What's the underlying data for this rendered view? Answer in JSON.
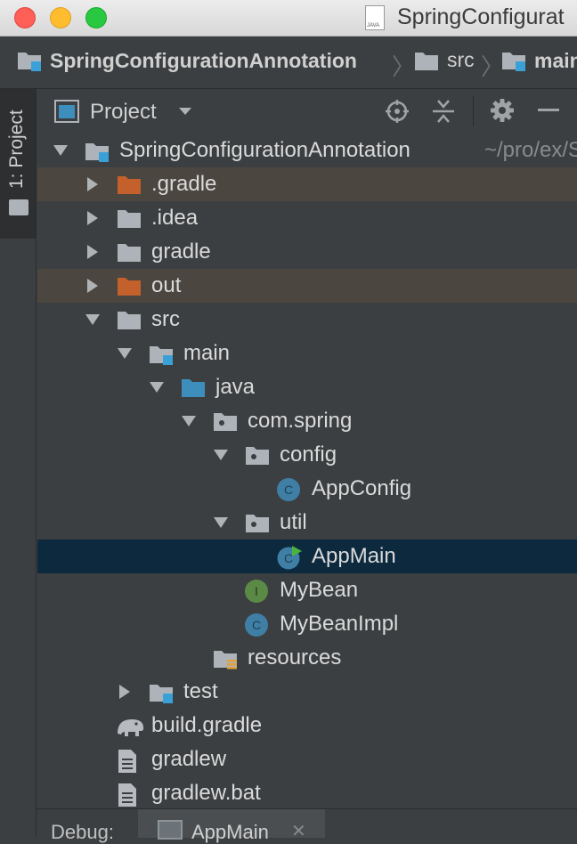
{
  "window": {
    "title": "SpringConfigurat",
    "file_icon": "java-file-icon"
  },
  "breadcrumbs": [
    {
      "label": "SpringConfigurationAnnotation",
      "icon": "module-folder-icon"
    },
    {
      "label": "src",
      "icon": "folder-icon"
    },
    {
      "label": "main",
      "icon": "source-folder-icon"
    }
  ],
  "tool_window": {
    "tab_label": "1: Project",
    "view_selector": "Project",
    "actions": [
      "locate-icon",
      "collapse-all-icon",
      "gear-icon",
      "hide-icon"
    ]
  },
  "tree": [
    {
      "label": "SpringConfigurationAnnotation",
      "hint": "~/pro/ex/S",
      "level": 0,
      "arrow": "down",
      "icon": "module-folder-icon"
    },
    {
      "label": ".gradle",
      "level": 1,
      "arrow": "right",
      "icon": "excluded-folder-icon",
      "excluded": true
    },
    {
      "label": ".idea",
      "level": 1,
      "arrow": "right",
      "icon": "folder-icon"
    },
    {
      "label": "gradle",
      "level": 1,
      "arrow": "right",
      "icon": "folder-icon"
    },
    {
      "label": "out",
      "level": 1,
      "arrow": "right",
      "icon": "excluded-folder-icon",
      "excluded": true
    },
    {
      "label": "src",
      "level": 1,
      "arrow": "down",
      "icon": "folder-icon"
    },
    {
      "label": "main",
      "level": 2,
      "arrow": "down",
      "icon": "module-folder-icon"
    },
    {
      "label": "java",
      "level": 3,
      "arrow": "down",
      "icon": "source-root-folder-icon"
    },
    {
      "label": "com.spring",
      "level": 4,
      "arrow": "down",
      "icon": "package-icon"
    },
    {
      "label": "config",
      "level": 5,
      "arrow": "down",
      "icon": "package-icon"
    },
    {
      "label": "AppConfig",
      "level": 6,
      "icon": "class-icon"
    },
    {
      "label": "util",
      "level": 5,
      "arrow": "down",
      "icon": "package-icon"
    },
    {
      "label": "AppMain",
      "level": 6,
      "icon": "runnable-class-icon",
      "selected": true
    },
    {
      "label": "MyBean",
      "level": 5,
      "icon": "interface-icon"
    },
    {
      "label": "MyBeanImpl",
      "level": 5,
      "icon": "class-icon"
    },
    {
      "label": "resources",
      "level": 4,
      "icon": "resources-folder-icon"
    },
    {
      "label": "test",
      "level": 2,
      "arrow": "right",
      "icon": "module-folder-icon"
    },
    {
      "label": "build.gradle",
      "level": 1,
      "icon": "gradle-elephant-icon"
    },
    {
      "label": "gradlew",
      "level": 1,
      "icon": "text-file-icon"
    },
    {
      "label": "gradlew.bat",
      "level": 1,
      "icon": "text-file-icon"
    }
  ],
  "bottom": {
    "debug_label": "Debug:",
    "tab_label": "AppMain"
  },
  "colors": {
    "tree_background": "#3c3f41",
    "selection": "#0d293e",
    "excluded_row": "#4b4640",
    "excluded_folder": "#c3602c",
    "folder": "#aeb3b9",
    "source_folder": "#3d8dbd",
    "class_icon": "#3f7fa6",
    "interface_icon": "#5b8a46"
  }
}
